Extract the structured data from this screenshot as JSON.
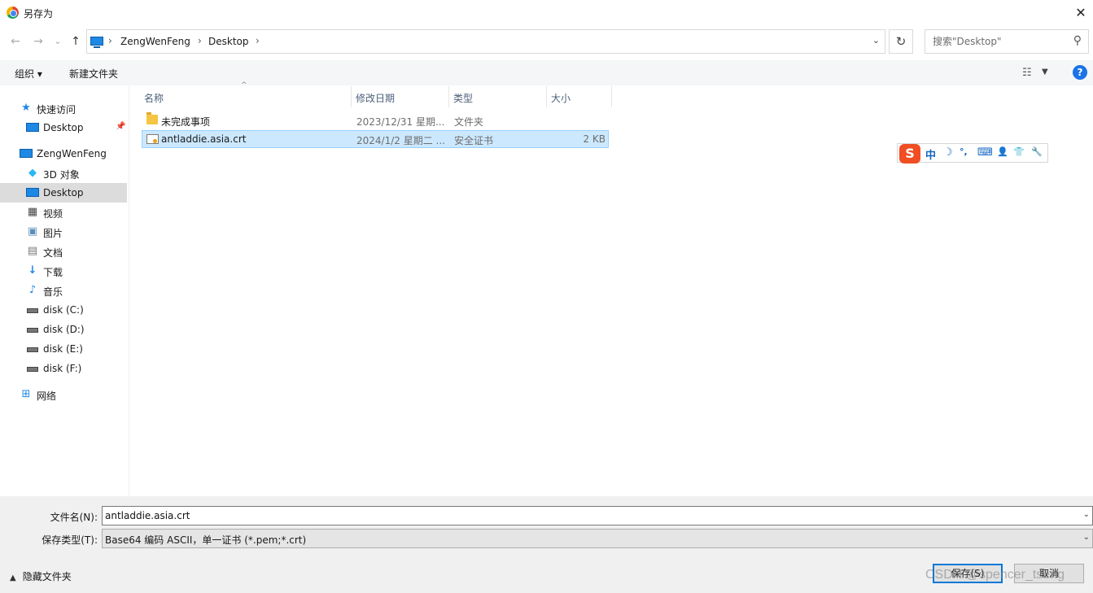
{
  "window": {
    "title": "另存为",
    "close_glyph": "✕"
  },
  "nav": {
    "back_glyph": "←",
    "forward_glyph": "→",
    "recent_glyph": "⌄",
    "up_glyph": "↑",
    "breadcrumb": [
      "ZengWenFeng",
      "Desktop"
    ],
    "refresh_glyph": "↻",
    "search_placeholder": "搜索\"Desktop\""
  },
  "toolbar": {
    "organize": "组织 ▾",
    "new_folder": "新建文件夹",
    "help": "?"
  },
  "sidebar": {
    "items": [
      {
        "label": "快速访问",
        "icon": "star-icon"
      },
      {
        "label": "Desktop",
        "icon": "desktop-icon",
        "pinned": true
      },
      {
        "label": "ZengWenFeng",
        "icon": "computer-icon"
      },
      {
        "label": "3D 对象",
        "icon": "cube-icon"
      },
      {
        "label": "Desktop",
        "icon": "desktop-icon",
        "selected": true
      },
      {
        "label": "视频",
        "icon": "video-icon"
      },
      {
        "label": "图片",
        "icon": "picture-icon"
      },
      {
        "label": "文档",
        "icon": "document-icon"
      },
      {
        "label": "下载",
        "icon": "download-icon"
      },
      {
        "label": "音乐",
        "icon": "music-icon"
      },
      {
        "label": "disk (C:)",
        "icon": "drive-icon"
      },
      {
        "label": "disk (D:)",
        "icon": "drive-icon"
      },
      {
        "label": "disk (E:)",
        "icon": "drive-icon"
      },
      {
        "label": "disk (F:)",
        "icon": "drive-icon"
      },
      {
        "label": "网络",
        "icon": "network-icon"
      }
    ]
  },
  "file_list": {
    "columns": [
      "名称",
      "修改日期",
      "类型",
      "大小"
    ],
    "rows": [
      {
        "name": "未完成事项",
        "modified": "2023/12/31 星期...",
        "type": "文件夹",
        "size": "",
        "icon": "folder-icon"
      },
      {
        "name": "antladdie.asia.crt",
        "modified": "2024/1/2 星期二 ...",
        "type": "安全证书",
        "size": "2 KB",
        "icon": "certificate-icon",
        "selected": true
      }
    ]
  },
  "ime": {
    "logo": "S",
    "mode": "中",
    "moon": "☽",
    "punct": "°,",
    "keyboard": "⌨",
    "user": "👤",
    "skin": "👕",
    "tool": "🔧"
  },
  "bottom": {
    "filename_label": "文件名(N):",
    "filename_value": "antladdie.asia.crt",
    "filetype_label": "保存类型(T):",
    "filetype_value": "Base64 编码 ASCII，单一证书 (*.pem;*.crt)",
    "hide_folders": "隐藏文件夹",
    "save_button": "保存(S)",
    "cancel_button": "取消"
  },
  "watermark": "CSDN @spencer_tseng"
}
